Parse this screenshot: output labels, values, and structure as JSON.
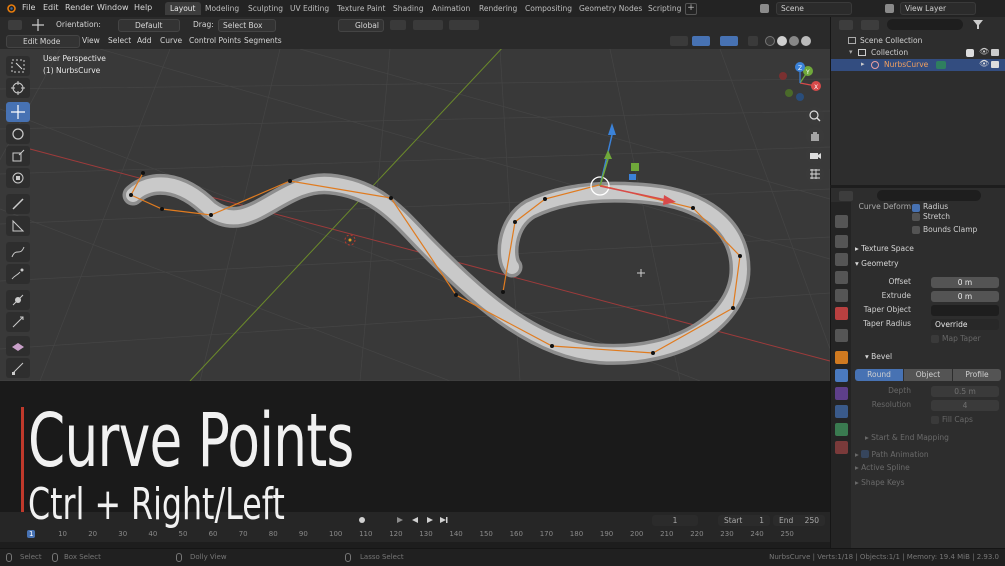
{
  "menu": [
    "File",
    "Edit",
    "Render",
    "Window",
    "Help"
  ],
  "workspaces": [
    "Layout",
    "Modeling",
    "Sculpting",
    "UV Editing",
    "Texture Paint",
    "Shading",
    "Animation",
    "Rendering",
    "Compositing",
    "Geometry Nodes",
    "Scripting"
  ],
  "active_workspace": "Layout",
  "scene_field": "Scene",
  "view_layer_field": "View Layer",
  "tool_header": {
    "orientation_label": "Orientation:",
    "orientation_value": "Default",
    "drag_label": "Drag:",
    "drag_value": "Select Box",
    "transform_value": "Global"
  },
  "view_header": {
    "mode": "Edit Mode",
    "items": [
      "View",
      "Select",
      "Add",
      "Curve",
      "Control Points",
      "Segments"
    ]
  },
  "viewport": {
    "perspective": "User Perspective",
    "object": "(1) NurbsCurve",
    "gizmo_axes": [
      "X",
      "Y",
      "Z"
    ]
  },
  "outliner": {
    "root": "Scene Collection",
    "collection": "Collection",
    "object": "NurbsCurve"
  },
  "properties": {
    "curve_deform_label": "Curve Deform",
    "radius_label": "Radius",
    "stretch_label": "Stretch",
    "bounds_clamp_label": "Bounds Clamp",
    "texture_space": "Texture Space",
    "geometry": "Geometry",
    "offset_label": "Offset",
    "offset_value": "0 m",
    "extrude_label": "Extrude",
    "extrude_value": "0 m",
    "taper_object_label": "Taper Object",
    "taper_radius_label": "Taper Radius",
    "taper_radius_value": "Override",
    "map_taper_label": "Map Taper",
    "bevel": "Bevel",
    "bevel_modes": [
      "Round",
      "Object",
      "Profile"
    ],
    "depth_label": "Depth",
    "depth_value": "0.5 m",
    "resolution_label": "Resolution",
    "resolution_value": "4",
    "fill_caps_label": "Fill Caps",
    "start_end_mapping": "Start & End Mapping",
    "path_animation": "Path Animation",
    "active_spline": "Active Spline",
    "shape_keys": "Shape Keys"
  },
  "overlay": {
    "title": "Curve Points",
    "subtitle": "Ctrl + Right/Left"
  },
  "timeline": {
    "current_frame": "1",
    "start_label": "Start",
    "start_value": "1",
    "end_label": "End",
    "end_value": "250",
    "ticks": [
      "1",
      "10",
      "20",
      "30",
      "40",
      "50",
      "60",
      "70",
      "80",
      "90",
      "100",
      "110",
      "120",
      "130",
      "140",
      "150",
      "160",
      "170",
      "180",
      "190",
      "200",
      "210",
      "220",
      "230",
      "240",
      "250"
    ]
  },
  "statusbar": {
    "select": "Select",
    "box_select": "Box Select",
    "dolly_view": "Dolly View",
    "lasso_select": "Lasso Select",
    "stats": "NurbsCurve | Verts:1/18 | Objects:1/1 | Memory: 19.4 MiB | 2.93.0"
  },
  "colors": {
    "accent": "#4772b3",
    "curve_line": "#e07b1f",
    "overlay_bar": "#c0392b"
  }
}
